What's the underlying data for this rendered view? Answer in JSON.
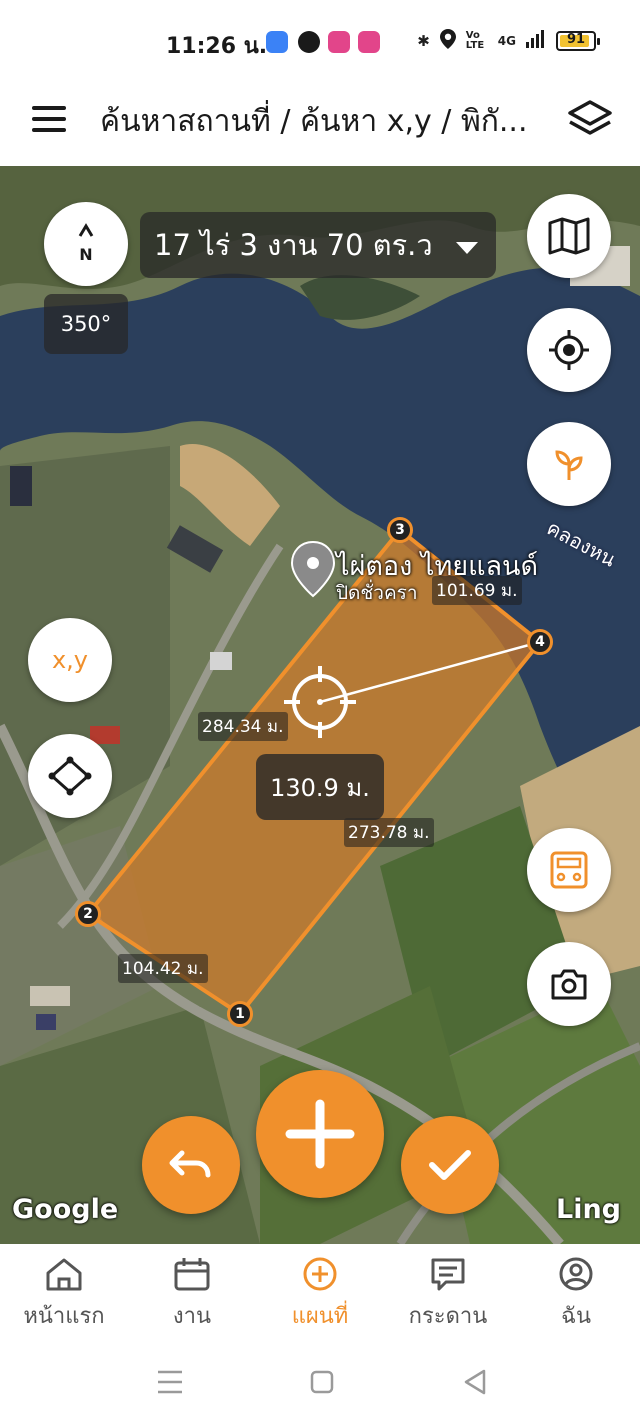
{
  "status_bar": {
    "time": "11:26 น.",
    "network": "4G",
    "volte": "Vo LTE",
    "battery_percent": "91",
    "battery_level": 0.91
  },
  "app_bar": {
    "title": "ค้นหาสถานที่ / ค้นหา x,y / พิกั...",
    "menu_icon": "hamburger-menu-icon",
    "layers_icon": "layers-icon"
  },
  "map": {
    "area_summary": "17 ไร่ 3 งาน 70 ตร.ว",
    "bearing": "350°",
    "xy_button": "x,y",
    "poi": {
      "name": "ไผ่ตอง ไทยแลนด์",
      "status": "ปิดชั่วครา"
    },
    "canal_label": "คลองหน",
    "edges": [
      {
        "id": "edge-3-4",
        "length": "101.69 ม."
      },
      {
        "id": "edge-2-3",
        "length": "284.34 ม."
      },
      {
        "id": "edge-4-1",
        "length": "273.78 ม."
      },
      {
        "id": "edge-1-2",
        "length": "104.42 ม."
      }
    ],
    "measured_distance": "130.9 ม.",
    "vertices": [
      "1",
      "2",
      "3",
      "4"
    ],
    "google_logo": "Google",
    "provider_logo": "Ling"
  },
  "bottom_nav": {
    "items": [
      {
        "label": "หน้าแรก",
        "icon": "home-icon",
        "active": false
      },
      {
        "label": "งาน",
        "icon": "calendar-icon",
        "active": false
      },
      {
        "label": "แผนที่",
        "icon": "plus-circle-icon",
        "active": true
      },
      {
        "label": "กระดาน",
        "icon": "board-icon",
        "active": false
      },
      {
        "label": "ฉัน",
        "icon": "profile-icon",
        "active": false
      }
    ]
  },
  "colors": {
    "accent": "#f0902c",
    "polygon_fill": "#d07a2a",
    "water": "#2b3f5c"
  }
}
